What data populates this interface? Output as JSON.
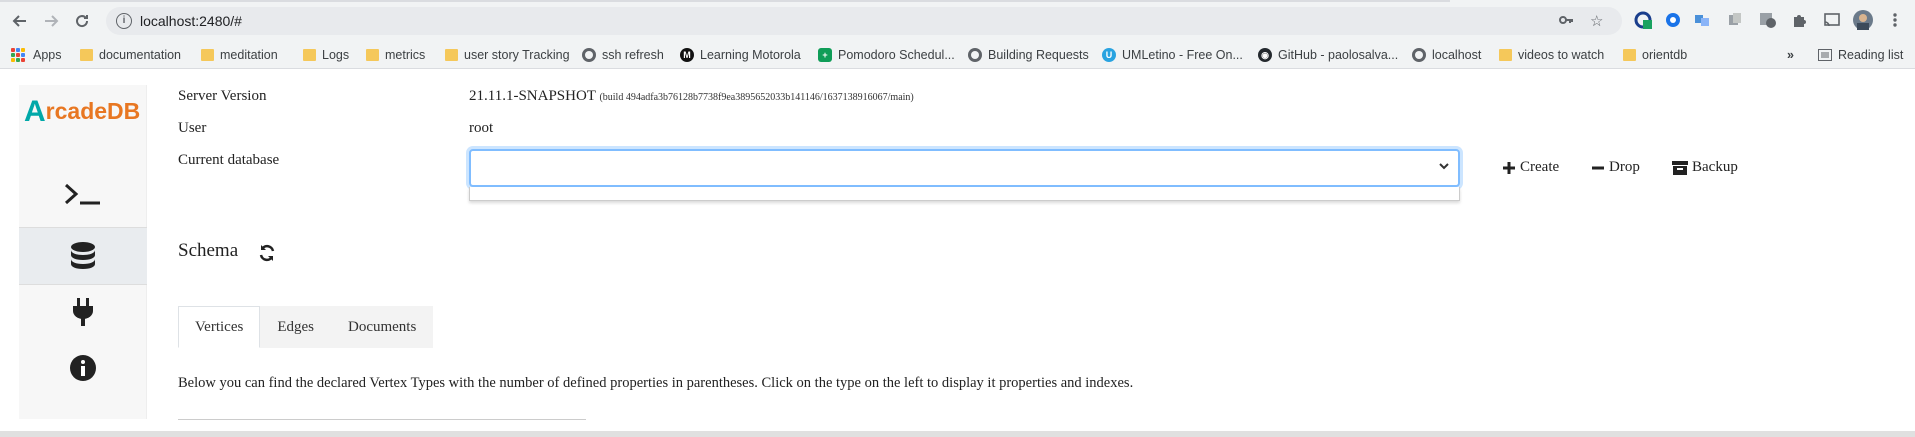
{
  "browser": {
    "url": "localhost:2480/#",
    "bookmarks": [
      {
        "label": "Apps",
        "icon": "apps-grid-icon"
      },
      {
        "label": "documentation",
        "icon": "folder-icon"
      },
      {
        "label": "meditation",
        "icon": "folder-icon"
      },
      {
        "label": "Logs",
        "icon": "folder-icon"
      },
      {
        "label": "metrics",
        "icon": "folder-icon"
      },
      {
        "label": "user story Tracking",
        "icon": "folder-icon"
      },
      {
        "label": "ssh refresh",
        "icon": "globe-icon"
      },
      {
        "label": "Learning Motorola",
        "icon": "motorola-icon"
      },
      {
        "label": "Pomodoro Schedul...",
        "icon": "sheets-icon"
      },
      {
        "label": "Building Requests",
        "icon": "globe-icon"
      },
      {
        "label": "UMLetino - Free On...",
        "icon": "umletino-icon"
      },
      {
        "label": "GitHub - paolosalva...",
        "icon": "github-icon"
      },
      {
        "label": "localhost",
        "icon": "globe-icon"
      },
      {
        "label": "videos to watch",
        "icon": "folder-icon"
      },
      {
        "label": "orientdb",
        "icon": "folder-icon"
      }
    ],
    "more": "»",
    "reading_list": "Reading list"
  },
  "app": {
    "logo_text_a": "A",
    "logo_text_rest": "rcadeDB",
    "server_version_label": "Server Version",
    "server_version": "21.11.1-SNAPSHOT",
    "server_build": "(build 494adfa3b76128b7738f9ea3895652033b141146/1637138916067/main)",
    "user_label": "User",
    "user": "root",
    "current_db_label": "Current database",
    "current_db_value": "",
    "actions": {
      "create": "Create",
      "drop": "Drop",
      "backup": "Backup"
    },
    "schema_title": "Schema",
    "tabs": [
      "Vertices",
      "Edges",
      "Documents"
    ],
    "active_tab": "Vertices",
    "description": "Below you can find the declared Vertex Types with the number of defined properties in parentheses. Click on the type on the left to display it properties and indexes."
  },
  "colors": {
    "accent_focus": "#80bdff",
    "logo_orange": "#e87722",
    "logo_teal": "#00a8a8"
  }
}
